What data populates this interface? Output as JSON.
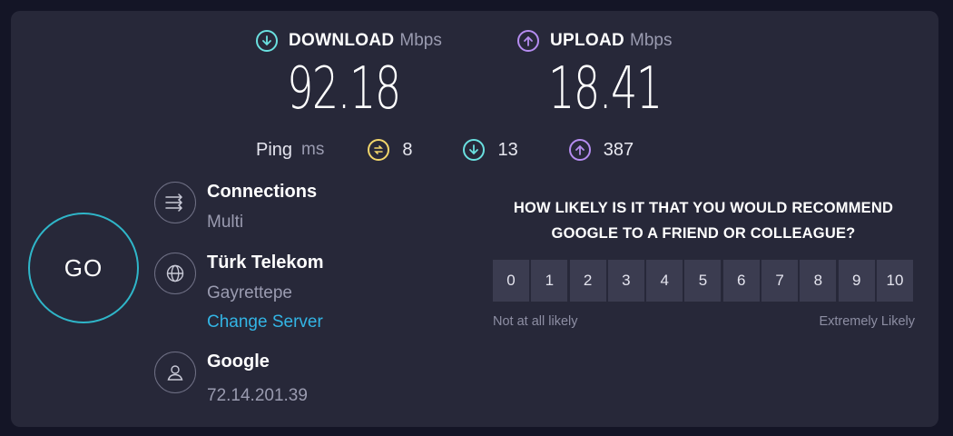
{
  "download": {
    "label": "DOWNLOAD",
    "unit": "Mbps",
    "value": "92.18",
    "icon": "arrow-down-circle-icon",
    "color": "#6ae0e0"
  },
  "upload": {
    "label": "UPLOAD",
    "unit": "Mbps",
    "value": "18.41",
    "icon": "arrow-up-circle-icon",
    "color": "#b58cf0"
  },
  "ping": {
    "label": "Ping",
    "unit": "ms",
    "idle": {
      "value": "8",
      "icon": "idle-latency-icon",
      "color": "#f2d66b"
    },
    "download": {
      "value": "13",
      "icon": "arrow-down-circle-icon",
      "color": "#6ae0e0"
    },
    "upload": {
      "value": "387",
      "icon": "arrow-up-circle-icon",
      "color": "#b58cf0"
    }
  },
  "go_button": {
    "label": "GO",
    "color": "#2fb6c9"
  },
  "connections": {
    "title": "Connections",
    "value": "Multi",
    "icon": "connections-icon"
  },
  "server": {
    "title": "Türk Telekom",
    "location": "Gayrettepe",
    "change_label": "Change Server",
    "icon": "globe-icon",
    "link_color": "#33b5e5"
  },
  "provider": {
    "title": "Google",
    "ip": "72.14.201.39",
    "icon": "user-icon"
  },
  "survey": {
    "question": "HOW LIKELY IS IT THAT YOU WOULD RECOMMEND GOOGLE TO A FRIEND OR COLLEAGUE?",
    "options": [
      "0",
      "1",
      "2",
      "3",
      "4",
      "5",
      "6",
      "7",
      "8",
      "9",
      "10"
    ],
    "low_label": "Not at all likely",
    "high_label": "Extremely Likely"
  }
}
